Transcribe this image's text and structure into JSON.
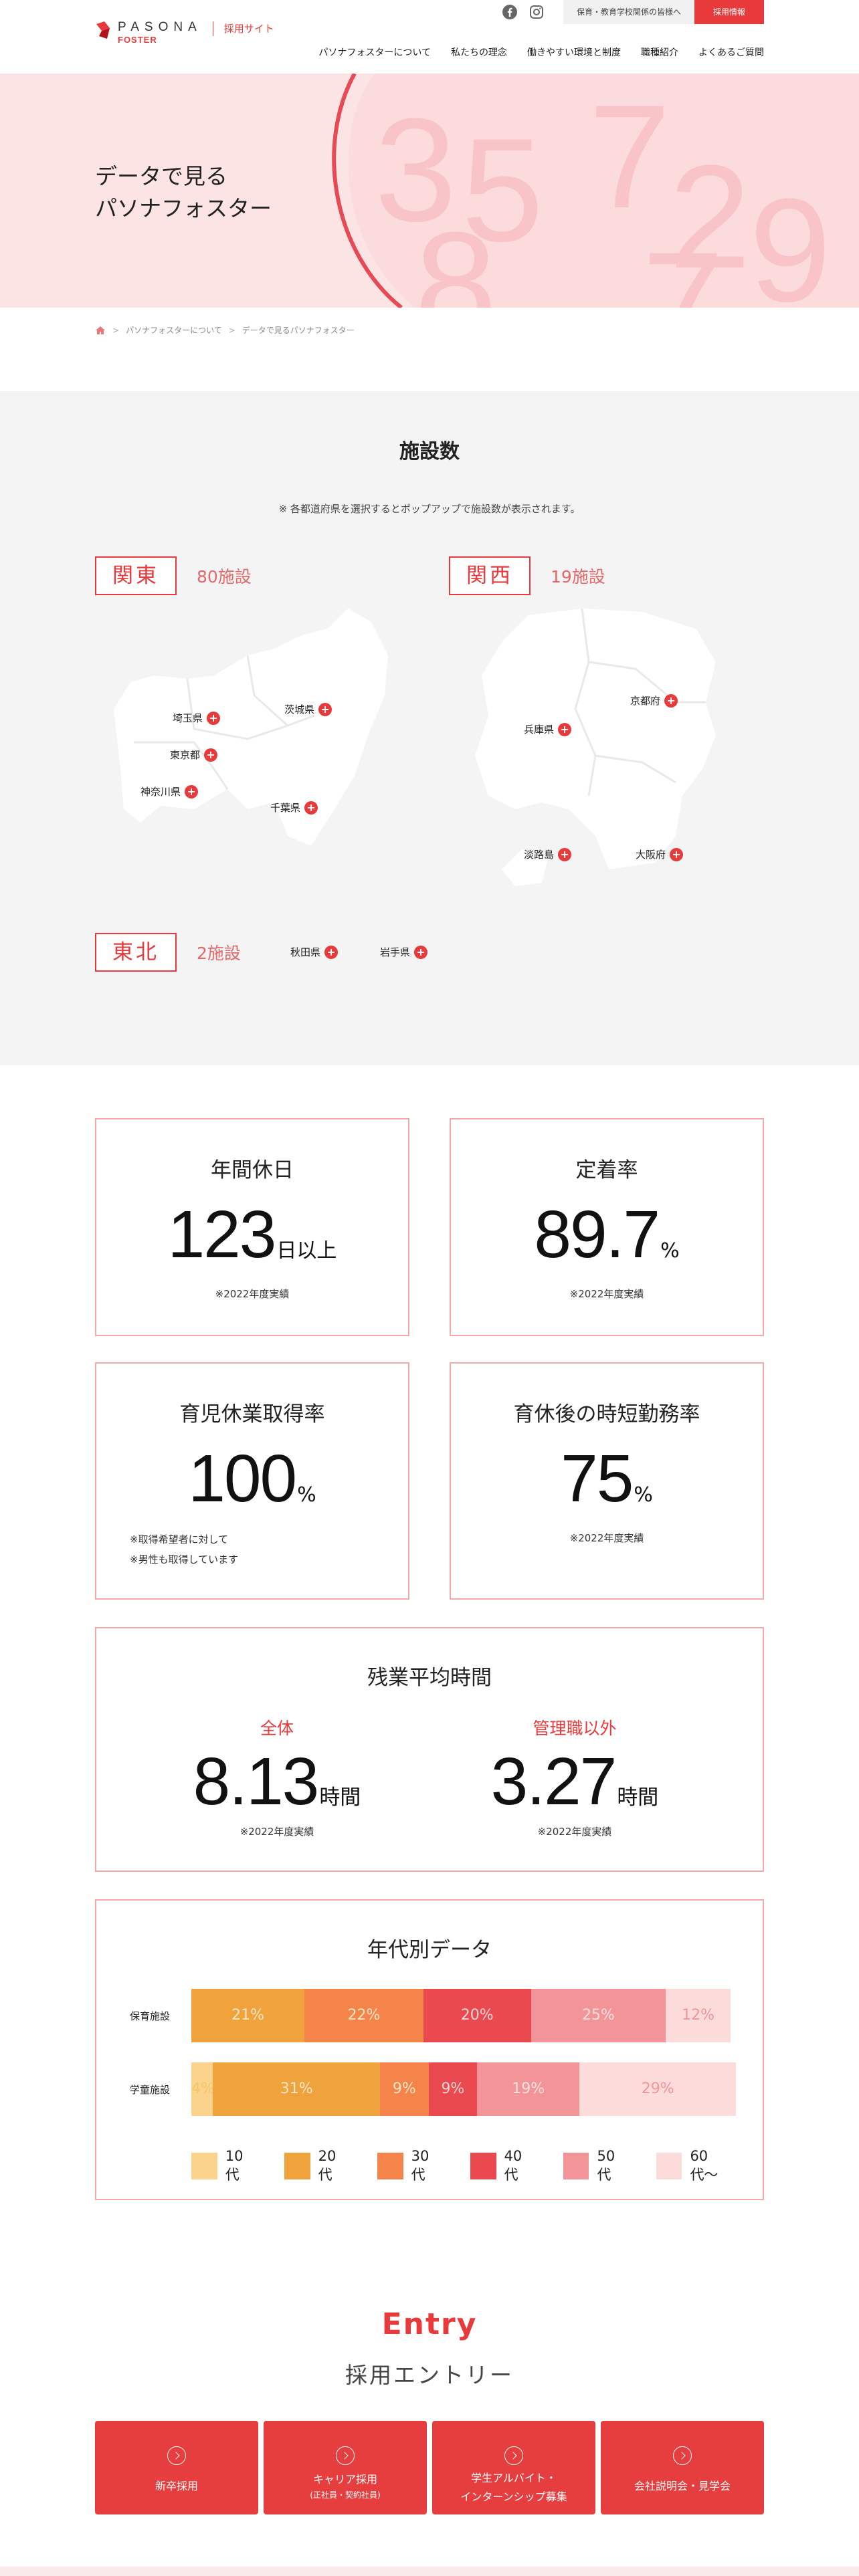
{
  "header": {
    "logo_main": "PASONA",
    "logo_sub": "FOSTER",
    "logo_recruit": "採用サイト",
    "edu_link": "保育・教育学校関係の皆様へ",
    "recruit_info": "採用情報",
    "nav": [
      "パソナフォスターについて",
      "私たちの理念",
      "働きやすい環境と制度",
      "職種紹介",
      "よくあるご質問"
    ]
  },
  "hero": {
    "title_line1": "データで見る",
    "title_line2": "パソナフォスター",
    "deco_numbers": [
      "3",
      "5",
      "7",
      "8",
      "2",
      "9",
      "7"
    ]
  },
  "breadcrumb": {
    "items": [
      "パソナフォスターについて",
      "データで見るパソナフォスター"
    ],
    "separator": ">"
  },
  "facilities": {
    "title": "施設数",
    "note": "※ 各都道府県を選択するとポップアップで施設数が表示されます。",
    "kanto": {
      "name": "関東",
      "count": "80施設",
      "prefs": [
        "埼玉県",
        "茨城県",
        "東京都",
        "神奈川県",
        "千葉県"
      ]
    },
    "kansai": {
      "name": "関西",
      "count": "19施設",
      "prefs": [
        "京都府",
        "兵庫県",
        "淡路島",
        "大阪府"
      ]
    },
    "tohoku": {
      "name": "東北",
      "count": "2施設",
      "prefs": [
        "秋田県",
        "岩手県"
      ]
    },
    "plus_symbol": "+"
  },
  "stats": {
    "holidays": {
      "title": "年間休日",
      "value": "123",
      "unit": "日以上",
      "note": "※2022年度実績"
    },
    "retention": {
      "title": "定着率",
      "value": "89.7",
      "unit": "%",
      "note": "※2022年度実績"
    },
    "childcare_leave": {
      "title": "育児休業取得率",
      "value": "100",
      "unit": "%",
      "note1": "※取得希望者に対して",
      "note2": "※男性も取得しています"
    },
    "short_hours": {
      "title": "育休後の時短勤務率",
      "value": "75",
      "unit": "%",
      "note": "※2022年度実績"
    },
    "overtime": {
      "title": "残業平均時間",
      "all_label": "全体",
      "all_value": "8.13",
      "non_mgmt_label": "管理職以外",
      "non_mgmt_value": "3.27",
      "unit": "時間",
      "note": "※2022年度実績"
    }
  },
  "age_chart_section": {
    "title": "年代別データ"
  },
  "chart_data": {
    "type": "bar",
    "orientation": "horizontal-stacked",
    "title": "年代別データ",
    "categories": [
      "保育施設",
      "学童施設"
    ],
    "series": [
      {
        "name": "10代",
        "color": "#fbd38c",
        "values": [
          0,
          4
        ]
      },
      {
        "name": "20代",
        "color": "#f0a33c",
        "values": [
          21,
          31
        ]
      },
      {
        "name": "30代",
        "color": "#f5844a",
        "values": [
          22,
          9
        ]
      },
      {
        "name": "40代",
        "color": "#ea4a4f",
        "values": [
          20,
          9
        ]
      },
      {
        "name": "50代",
        "color": "#f39499",
        "values": [
          25,
          19
        ]
      },
      {
        "name": "60代〜",
        "color": "#fbdcdb",
        "values": [
          12,
          29
        ]
      }
    ],
    "label_colors": [
      "#f5c56a",
      "#ffe6c4",
      "#ffe6c4",
      "#ffd7d7",
      "#ffe0e0",
      "#f39499"
    ],
    "value_suffix": "%",
    "legend_placement": "bottom"
  },
  "entry": {
    "title_en": "Entry",
    "title_ja": "採用エントリー",
    "buttons": [
      {
        "label": "新卒採用",
        "sub": ""
      },
      {
        "label": "キャリア採用",
        "sub": "(正社員・契約社員)"
      },
      {
        "label": "学生アルバイト・",
        "label2": "インターンシップ募集"
      },
      {
        "label": "会社説明会・見学会",
        "sub": ""
      }
    ]
  },
  "colors": {
    "accent": "#e83a3a",
    "hero_bg": "#fde4e4",
    "section_gray": "#f4f4f4",
    "card_border": "#f3a9a9"
  }
}
